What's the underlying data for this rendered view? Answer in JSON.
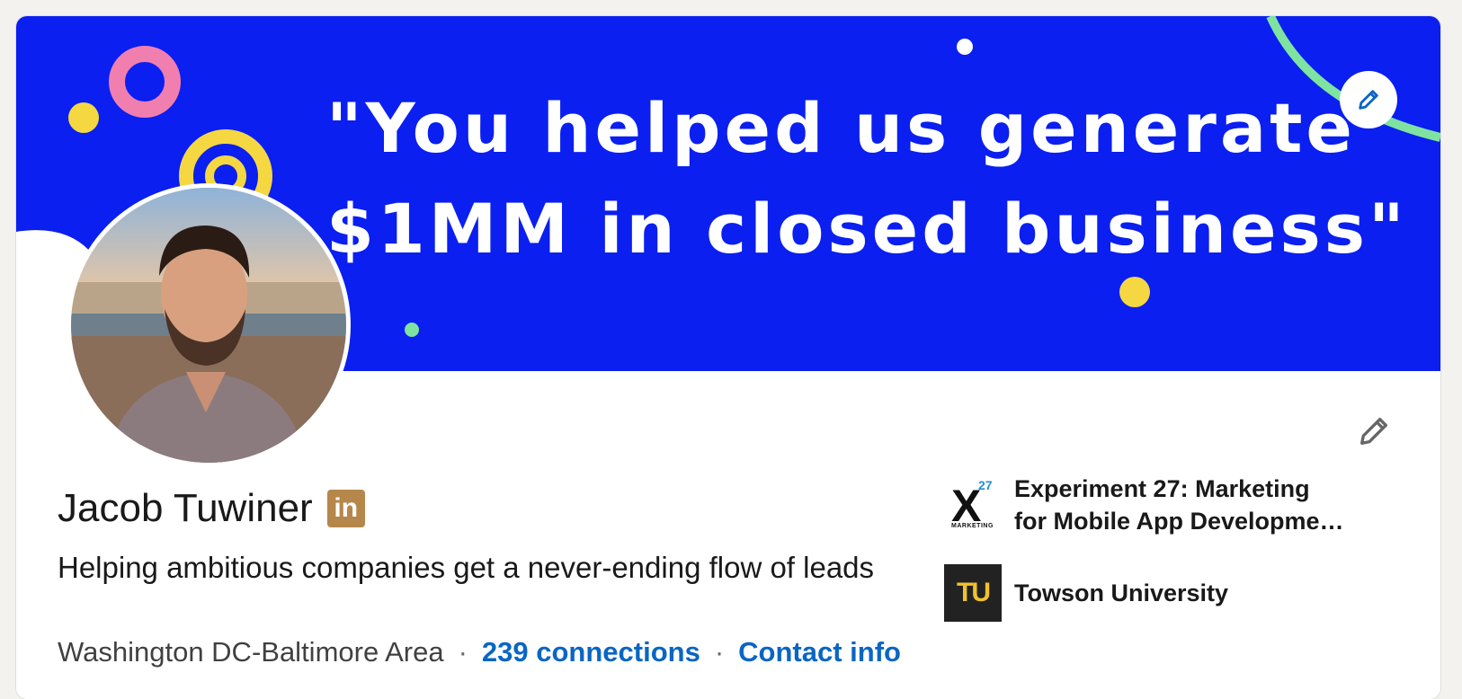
{
  "banner": {
    "line1": "\"You helped us generate",
    "line2": "$1MM in closed business\"",
    "background": "#0a1ff0"
  },
  "profile": {
    "name": "Jacob Tuwiner",
    "badge": "in",
    "headline": "Helping ambitious companies get a never-ending flow of leads",
    "location": "Washington DC-Baltimore Area",
    "separator": "·",
    "connections": "239 connections",
    "contact": "Contact info"
  },
  "organizations": [
    {
      "name": "Experiment 27: Marketing for Mobile App Developme…",
      "logo_text": "X",
      "logo_sup": "27",
      "logo_sub": "MARKETING"
    },
    {
      "name": "Towson University",
      "logo_text": "TU"
    }
  ],
  "icons": {
    "edit_cover": "pencil-icon",
    "edit_intro": "pencil-icon"
  },
  "colors": {
    "link": "#0a66c2",
    "badge": "#b5874a",
    "page_bg": "#f3f2ef"
  }
}
